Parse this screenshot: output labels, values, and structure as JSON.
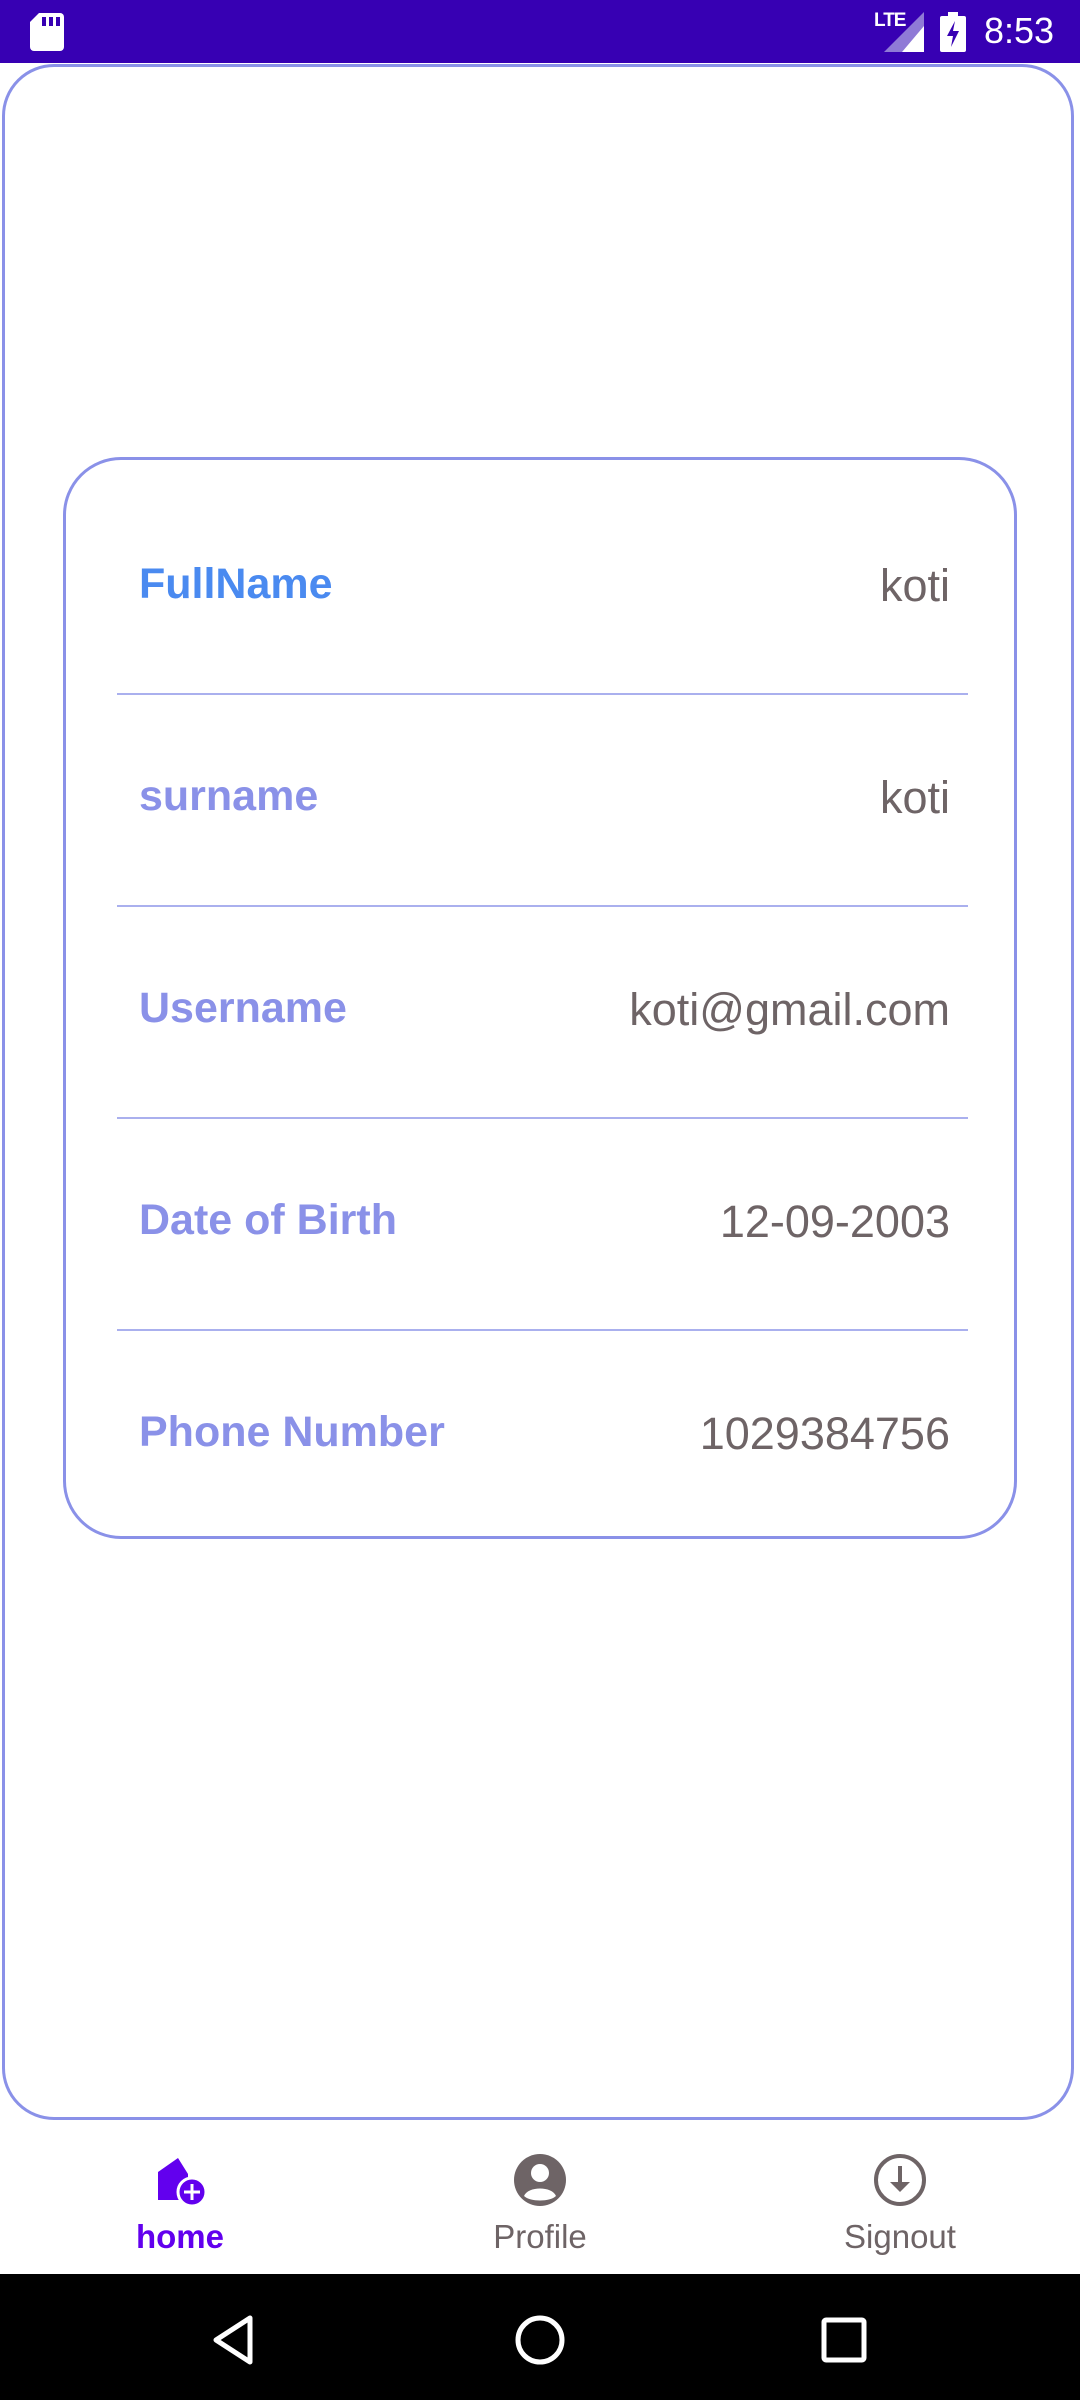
{
  "status_bar": {
    "time": "8:53",
    "network": "LTE",
    "icons": [
      "sd-card-icon",
      "signal-icon",
      "battery-charging-icon"
    ]
  },
  "profile": {
    "fields": [
      {
        "label": "FullName",
        "value": "koti"
      },
      {
        "label": "surname",
        "value": "koti"
      },
      {
        "label": "Username",
        "value": "koti@gmail.com"
      },
      {
        "label": "Date of Birth",
        "value": "12-09-2003"
      },
      {
        "label": "Phone Number",
        "value": "1029384756"
      }
    ]
  },
  "bottom_nav": {
    "items": [
      {
        "label": "home",
        "icon": "home-add-icon",
        "active": true
      },
      {
        "label": "Profile",
        "icon": "account-circle-icon",
        "active": false
      },
      {
        "label": "Signout",
        "icon": "download-circle-icon",
        "active": false
      }
    ]
  },
  "system_nav": {
    "buttons": [
      "back-icon",
      "home-circle-icon",
      "recents-icon"
    ]
  },
  "colors": {
    "status_bar": "#3700b3",
    "accent": "#8a91e8",
    "active_label": "#4a8af0",
    "nav_active": "#6200ee",
    "value_text": "#6e6466"
  }
}
